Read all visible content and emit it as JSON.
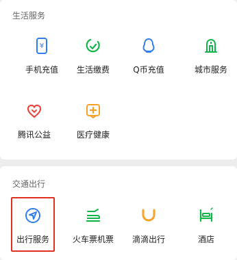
{
  "life_section": {
    "title": "生活服务",
    "items": [
      {
        "label": "手机充值",
        "icon": "mobile-recharge-icon"
      },
      {
        "label": "生活缴费",
        "icon": "utility-payment-icon"
      },
      {
        "label": "Q币充值",
        "icon": "qcoin-recharge-icon"
      },
      {
        "label": "城市服务",
        "icon": "city-service-icon"
      },
      {
        "label": "腾讯公益",
        "icon": "charity-heart-icon"
      },
      {
        "label": "医疗健康",
        "icon": "medical-health-icon"
      }
    ]
  },
  "travel_section": {
    "title": "交通出行",
    "items": [
      {
        "label": "出行服务",
        "icon": "travel-service-icon"
      },
      {
        "label": "火车票机票",
        "icon": "train-plane-ticket-icon"
      },
      {
        "label": "滴滴出行",
        "icon": "didi-icon"
      },
      {
        "label": "酒店",
        "icon": "hotel-bed-icon"
      }
    ]
  },
  "colors": {
    "blue": "#2f7bf0",
    "green": "#12b549",
    "orange": "#f7a226",
    "red": "#e8483f",
    "highlight": "#e0301e"
  }
}
